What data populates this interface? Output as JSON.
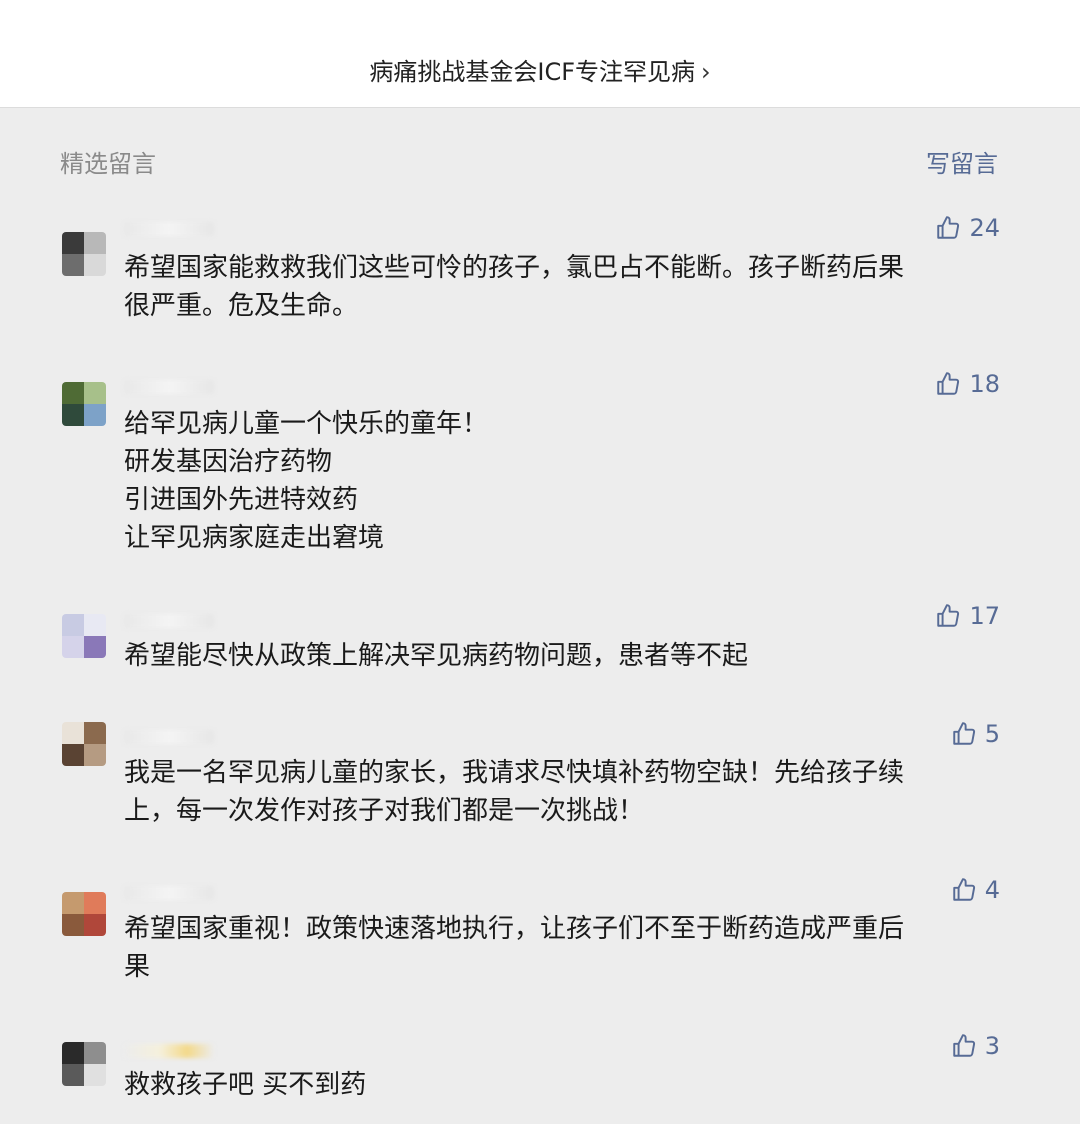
{
  "header": {
    "account_link": "病痛挑战基金会ICF专注罕见病",
    "chevron_icon": "chevron-right-icon"
  },
  "section": {
    "title": "精选留言",
    "write_label": "写留言"
  },
  "comments": [
    {
      "likes": "24",
      "text": "希望国家能救救我们这些可怜的孩子，氯巴占不能断。孩子断药后果\n很严重。危及生命。",
      "avatar_colors": [
        "#3a3a3a",
        "#b8b8b8",
        "#6d6d6d",
        "#d9d9d9"
      ]
    },
    {
      "likes": "18",
      "text": "给罕见病儿童一个快乐的童年！\n研发基因治疗药物\n引进国外先进特效药\n让罕见病家庭走出窘境",
      "avatar_colors": [
        "#4f6b35",
        "#a7c08a",
        "#2f4a3b",
        "#7da2c8"
      ]
    },
    {
      "likes": "17",
      "text": "希望能尽快从政策上解决罕见病药物问题，患者等不起",
      "avatar_colors": [
        "#c8cbe3",
        "#e8e9f3",
        "#d5d3ea",
        "#8a78b8"
      ]
    },
    {
      "likes": "5",
      "text": "我是一名罕见病儿童的家长，我请求尽快填补药物空缺！先给孩子续\n上，每一次发作对孩子对我们都是一次挑战！",
      "avatar_colors": [
        "#e9e2d8",
        "#8b6a4e",
        "#5a4333",
        "#b59b82"
      ]
    },
    {
      "likes": "4",
      "text": "希望国家重视！政策快速落地执行，让孩子们不至于断药造成严重后\n果",
      "avatar_colors": [
        "#c59a6e",
        "#e07b5a",
        "#8a5a3c",
        "#b0473a"
      ]
    },
    {
      "likes": "3",
      "text": "救救孩子吧 买不到药",
      "avatar_colors": [
        "#2a2a2a",
        "#8e8e8e",
        "#5a5a5a",
        "#e0e0e0"
      ]
    }
  ],
  "icons": {
    "like": "thumbs-up-icon"
  },
  "colors": {
    "link_blue": "#576b95",
    "muted_gray": "#8a8a8a",
    "page_bg": "#ededed"
  }
}
